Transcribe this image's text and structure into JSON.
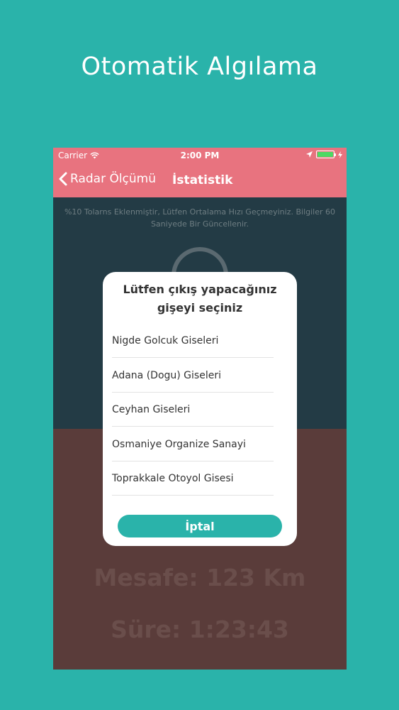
{
  "promo": {
    "title": "Otomatik Algılama"
  },
  "statusbar": {
    "carrier": "Carrier",
    "time": "2:00 PM"
  },
  "navbar": {
    "back_label": "Radar Ölçümü",
    "title": "İstatistik"
  },
  "content": {
    "info": "%10 Tolarns Eklenmiştir, Lütfen Ortalama Hızı Geçmeyiniz. Bilgiler 60 Saniyede Bir Güncellenir.",
    "distance": "Mesafe: 123 Km",
    "duration": "Süre: 1:23:43"
  },
  "dialog": {
    "title": "Lütfen çıkış yapacağınız gişeyi seçiniz",
    "options": [
      "Nigde Golcuk Giseleri",
      "Adana (Dogu) Giseleri",
      "Ceyhan Giseleri",
      "Osmaniye Organize Sanayi",
      "Toprakkale Otoyol Gisesi"
    ],
    "cancel_label": "İptal"
  },
  "colors": {
    "background": "#2ab3aa",
    "navbar": "#e8737f",
    "accent": "#2ab3aa"
  }
}
